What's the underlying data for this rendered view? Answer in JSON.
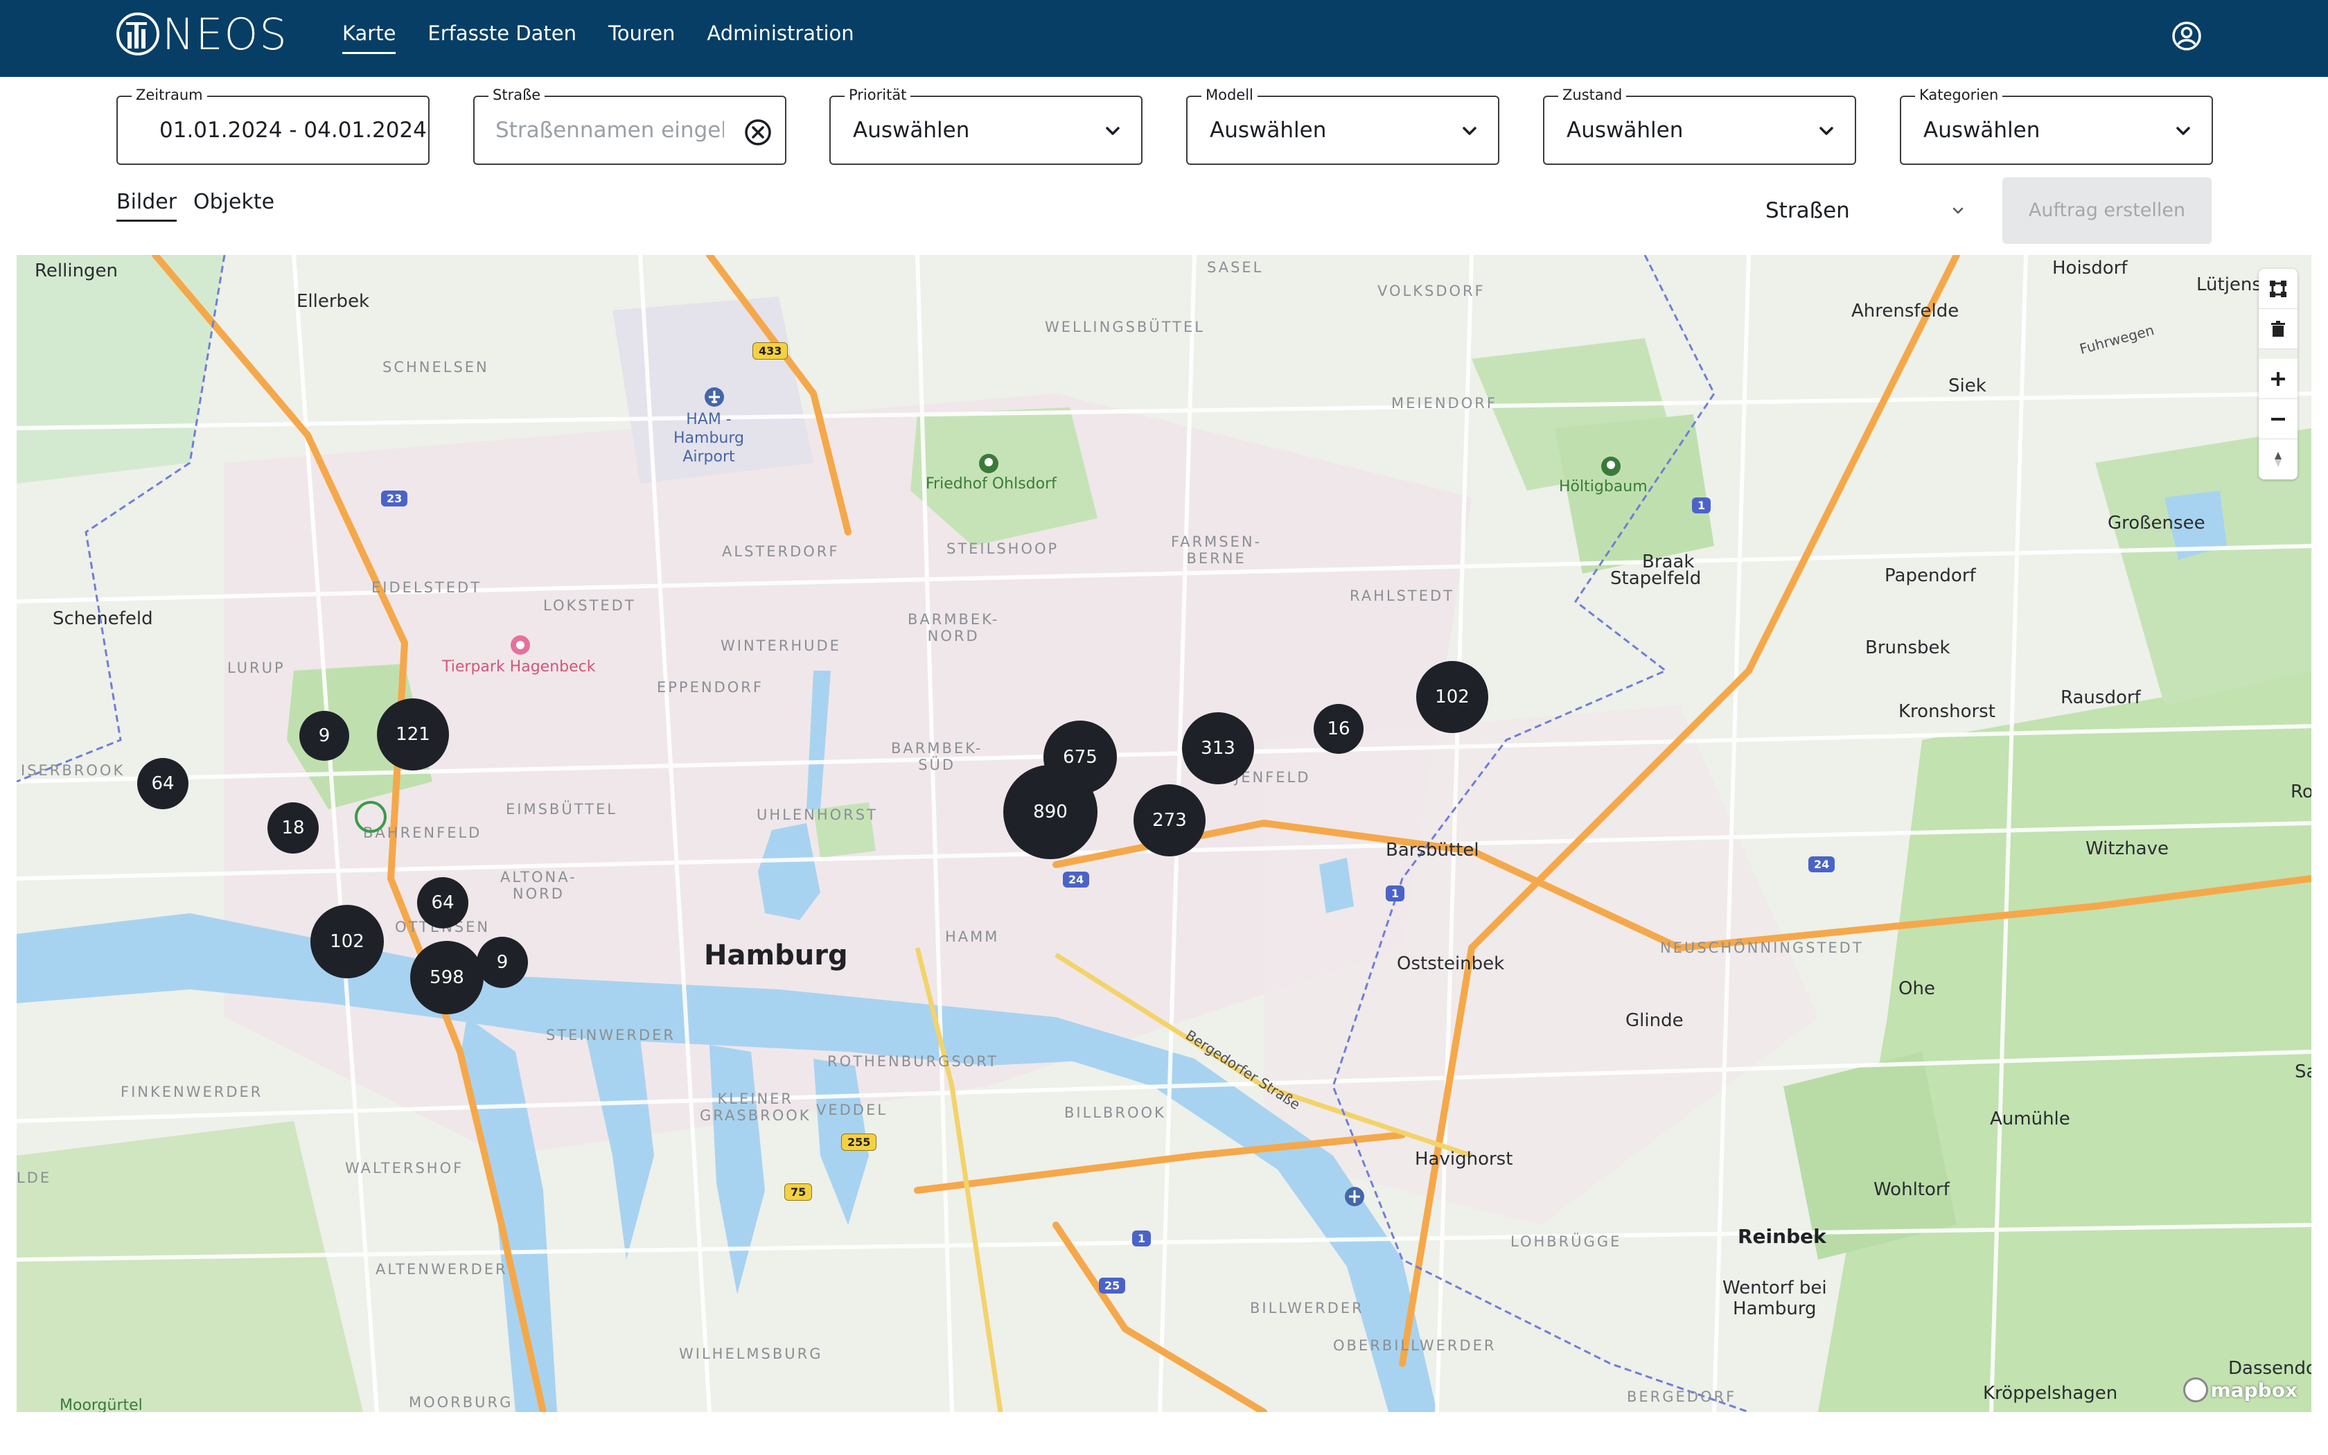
{
  "header": {
    "logo_text": "NEOS",
    "nav": [
      "Karte",
      "Erfasste Daten",
      "Touren",
      "Administration"
    ],
    "active_nav": "Karte"
  },
  "filters": {
    "zeitraum": {
      "label": "Zeitraum",
      "value": "01.01.2024 - 04.01.2024"
    },
    "strasse": {
      "label": "Straße",
      "placeholder": "Straßennamen eingebe"
    },
    "prioritaet": {
      "label": "Priorität",
      "value": "Auswählen"
    },
    "modell": {
      "label": "Modell",
      "value": "Auswählen"
    },
    "zustand": {
      "label": "Zustand",
      "value": "Auswählen"
    },
    "kategorien": {
      "label": "Kategorien",
      "value": "Auswählen"
    }
  },
  "tabs": [
    "Bilder",
    "Objekte"
  ],
  "active_tab": "Bilder",
  "street_select": "Straßen",
  "order_button": "Auftrag erstellen",
  "map": {
    "city": "Hamburg",
    "clusters": [
      "9",
      "121",
      "64",
      "18",
      "64",
      "102",
      "598",
      "9",
      "675",
      "890",
      "313",
      "273",
      "16",
      "102"
    ],
    "labels": {
      "rellingen": "Rellingen",
      "ellerbek": "Ellerbek",
      "schnelsen": "SCHNELSEN",
      "airport": "HAM -\nHamburg\nAirport",
      "sasel": "SASEL",
      "volksdorf": "VOLKSDORF",
      "wellingsbuettel": "WELLINGSBÜTTEL",
      "hoisdorf": "Hoisdorf",
      "ahrensfelde": "Ahrensfelde",
      "luetjens": "Lütjens",
      "fuhrwegen": "Fuhrwegen",
      "siek": "Siek",
      "meiendorf": "MEIENDORF",
      "friedhof": "Friedhof Ohlsdorf",
      "hoeltigbaum": "Höltigbaum",
      "grossensee": "Großensee",
      "alsterdorf": "ALSTERDORF",
      "steilshoop": "STEILSHOOP",
      "farmsen": "FARMSEN-\nBERNE",
      "braak": "Braak",
      "papendorf": "Papendorf",
      "stapelfeld": "Stapelfeld",
      "eidelstedt": "EIDELSTEDT",
      "lokstedt": "LOKSTEDT",
      "rahlstedt": "RAHLSTEDT",
      "schenefeld": "Schenefeld",
      "winterhude": "WINTERHUDE",
      "barmbek_nord": "BARMBEK-\nNORD",
      "brunsbek": "Brunsbek",
      "tierpark": "Tierpark Hagenbeck",
      "lurup": "LURUP",
      "eppendorf": "EPPENDORF",
      "kronshorst": "Kronshorst",
      "rausdorf": "Rausdorf",
      "iserbrook": "ISERBROOK",
      "barmbek_sued": "BARMBEK-\nSÜD",
      "jenfeld": "JENFELD",
      "eimsbuettel": "EIMSBÜTTEL",
      "uhlenhorst": "UHLENHORST",
      "bahrenfeld": "BAHRENFELD",
      "barsbuettel": "Barsbüttel",
      "witzhave": "Witzhave",
      "altona": "ALTONA-\nNORD",
      "ottensen": "OTTENSEN",
      "hamm": "HAMM",
      "oststeinbek": "Oststeinbek",
      "neuschoenningstedt": "NEUSCHÖNNINGSTEDT",
      "ohe": "Ohe",
      "glinde": "Glinde",
      "steinwerder": "STEINWERDER",
      "rothenburgsort": "ROTHENBURGSORT",
      "bergedorfer": "Bergedorfer Straße",
      "finkenwerder": "FINKENWERDER",
      "kleiner_grasbrook": "KLEINER\nGRASBROOK",
      "veddel": "VEDDEL",
      "billbrook": "BILLBROOK",
      "havighorst": "Havighorst",
      "aumuehle": "Aumühle",
      "waltershof": "WALTERSHOF",
      "wohltorf": "Wohltorf",
      "lohbruegge": "LOHBRÜGGE",
      "reinbek": "Reinbek",
      "altenwerder": "ALTENWERDER",
      "wentorf": "Wentorf bei\nHamburg",
      "billwerder": "BILLWERDER",
      "oberbillwerder": "OBERBILLWERDER",
      "wilhelmsburg": "WILHELMSBURG",
      "dassendorf": "Dassendo",
      "moorburg": "MOORBURG",
      "moorguertel": "Moorgürtel",
      "bergedorf": "BERGEDORF",
      "kroeppelshagen": "Kröppelshagen",
      "ro": "Ro",
      "sa": "Sa",
      "lde": "LDE"
    },
    "shields": [
      "433",
      "23",
      "1",
      "24",
      "24",
      "1",
      "255",
      "75",
      "1",
      "25",
      "24"
    ],
    "attribution": "mapbox"
  },
  "colors": {
    "header_bg": "#063e66",
    "cluster": "#1e2228",
    "water": "#a8d3f0",
    "park": "#c6e3b7",
    "highway": "#f5a84a"
  }
}
